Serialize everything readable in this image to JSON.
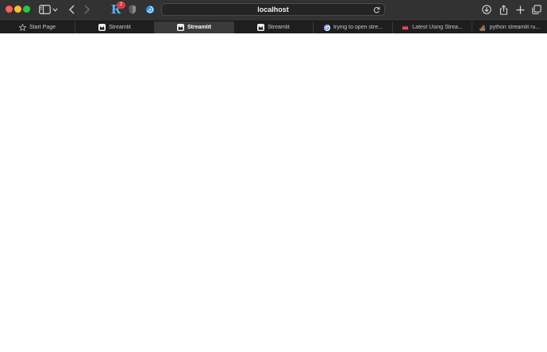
{
  "window": {
    "traffic_lights": {
      "close": "#ff5f57",
      "minimize": "#febc2e",
      "maximize": "#28c840"
    }
  },
  "toolbar": {
    "sidebar_icon": "sidebar-icon",
    "chevron_icon": "chevron-down-icon",
    "back_icon": "back-arrow-icon",
    "forward_icon": "forward-arrow-icon",
    "extensions": [
      {
        "name": "r-extension-icon",
        "letter": "R",
        "badge": "2",
        "color": "#5ab0ff",
        "badge_color": "#e03a3a"
      },
      {
        "name": "shield-extension-icon"
      },
      {
        "name": "circle-extension-icon",
        "color": "#3fa9f5"
      }
    ],
    "address": {
      "text": "localhost",
      "reload_icon": "reload-icon"
    },
    "right_icons": [
      "download-icon",
      "share-icon",
      "plus-icon",
      "tabs-overview-icon"
    ]
  },
  "tabs": [
    {
      "label": "Start Page",
      "favicon": "star-icon",
      "active": false
    },
    {
      "label": "Streamlit",
      "favicon": "streamlit-icon",
      "active": false
    },
    {
      "label": "Streamlit",
      "favicon": "streamlit-icon",
      "active": true
    },
    {
      "label": "Streamlit",
      "favicon": "streamlit-icon",
      "active": false
    },
    {
      "label": "trying to open stre...",
      "favicon": "google-icon",
      "active": false
    },
    {
      "label": "Latest Using Strea...",
      "favicon": "streamlit-crown-icon",
      "active": false
    },
    {
      "label": "python streamlit ru...",
      "favicon": "stackoverflow-icon",
      "active": false
    }
  ],
  "colors": {
    "toolbar_bg": "#323232",
    "tabbar_bg": "#1e1e1e",
    "active_tab_bg": "#3b3b3b",
    "content_bg": "#ffffff"
  }
}
